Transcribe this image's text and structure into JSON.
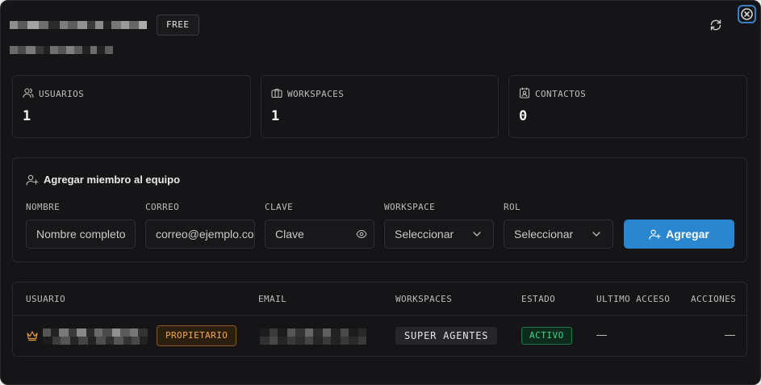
{
  "header": {
    "plan_badge": "FREE"
  },
  "stats": [
    {
      "label": "USUARIOS",
      "value": "1",
      "icon": "users-icon"
    },
    {
      "label": "WORKSPACES",
      "value": "1",
      "icon": "briefcase-icon"
    },
    {
      "label": "CONTACTOS",
      "value": "0",
      "icon": "contact-icon"
    }
  ],
  "add_member": {
    "title": "Agregar miembro al equipo",
    "fields": {
      "name": {
        "label": "NOMBRE",
        "placeholder": "Nombre completo"
      },
      "email": {
        "label": "CORREO",
        "placeholder": "correo@ejemplo.com"
      },
      "password": {
        "label": "CLAVE",
        "placeholder": "Clave"
      },
      "workspace": {
        "label": "WORKSPACE",
        "value": "Seleccionar"
      },
      "role": {
        "label": "ROL",
        "value": "Seleccionar"
      }
    },
    "submit_label": "Agregar"
  },
  "table": {
    "headers": [
      "USUARIO",
      "EMAIL",
      "WORKSPACES",
      "ESTADO",
      "ULTIMO ACCESO",
      "ACCIONES"
    ],
    "rows": [
      {
        "role": "PROPIETARIO",
        "workspace": "SUPER AGENTES",
        "status": "ACTIVO",
        "last_access": "—",
        "actions": "—"
      }
    ]
  },
  "colors": {
    "accent": "#2a86cf",
    "owner": "#f0a94a",
    "active": "#3ed58a",
    "background": "#151517"
  }
}
